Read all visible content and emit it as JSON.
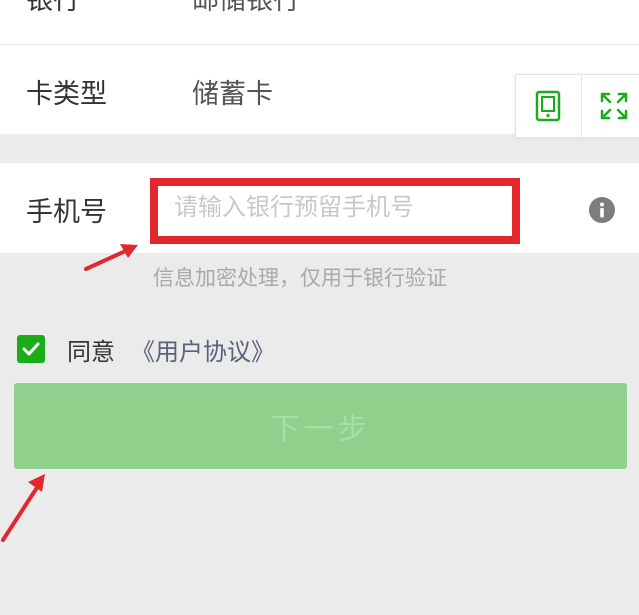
{
  "bank_row": {
    "label": "银行",
    "value": "邮储银行"
  },
  "card_type_row": {
    "label": "卡类型",
    "value": "储蓄卡"
  },
  "floating_tools": {
    "icons": [
      "tablet-icon",
      "expand-icon"
    ],
    "accent_color": "#1aad19"
  },
  "phone_row": {
    "label": "手机号",
    "input_value": "",
    "placeholder": "请输入银行预留手机号",
    "info_icon": "info-icon"
  },
  "hint": "信息加密处理，仅用于银行验证",
  "agreement": {
    "checked": true,
    "text": "同意",
    "link": "《用户协议》"
  },
  "next_button": {
    "label": "下一步",
    "color": "#8fd08d"
  },
  "annotations": {
    "highlight_color": "#e0282d"
  }
}
